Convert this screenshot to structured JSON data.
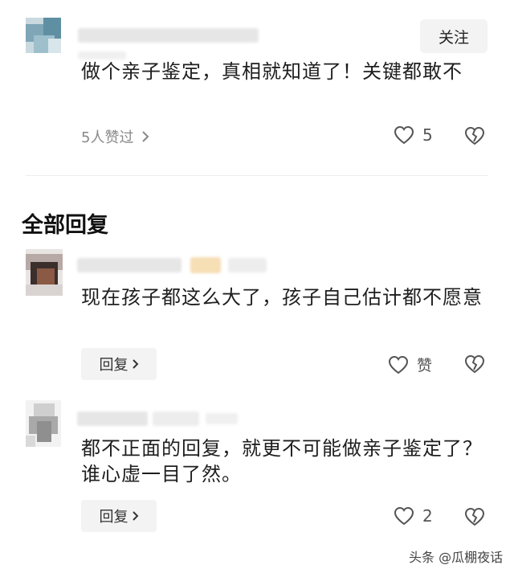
{
  "top_comment": {
    "follow_label": "关注",
    "text": "做个亲子鉴定，真相就知道了！关键都敢不",
    "likers_text": "5人赞过",
    "like_count": "5"
  },
  "section": {
    "title": "全部回复"
  },
  "replies": [
    {
      "text": "现在孩子都这么大了，孩子自己估计都不愿意",
      "reply_label": "回复",
      "like_text": "赞"
    },
    {
      "text": "都不正面的回复，就更不可能做亲子鉴定了？谁心虚一目了然。",
      "reply_label": "回复",
      "like_text": "2"
    }
  ],
  "watermark": {
    "text": "头条 @瓜棚夜话"
  },
  "colors": {
    "text": "#1e1e1e",
    "meta": "#888888",
    "button_bg": "#f3f3f3"
  }
}
